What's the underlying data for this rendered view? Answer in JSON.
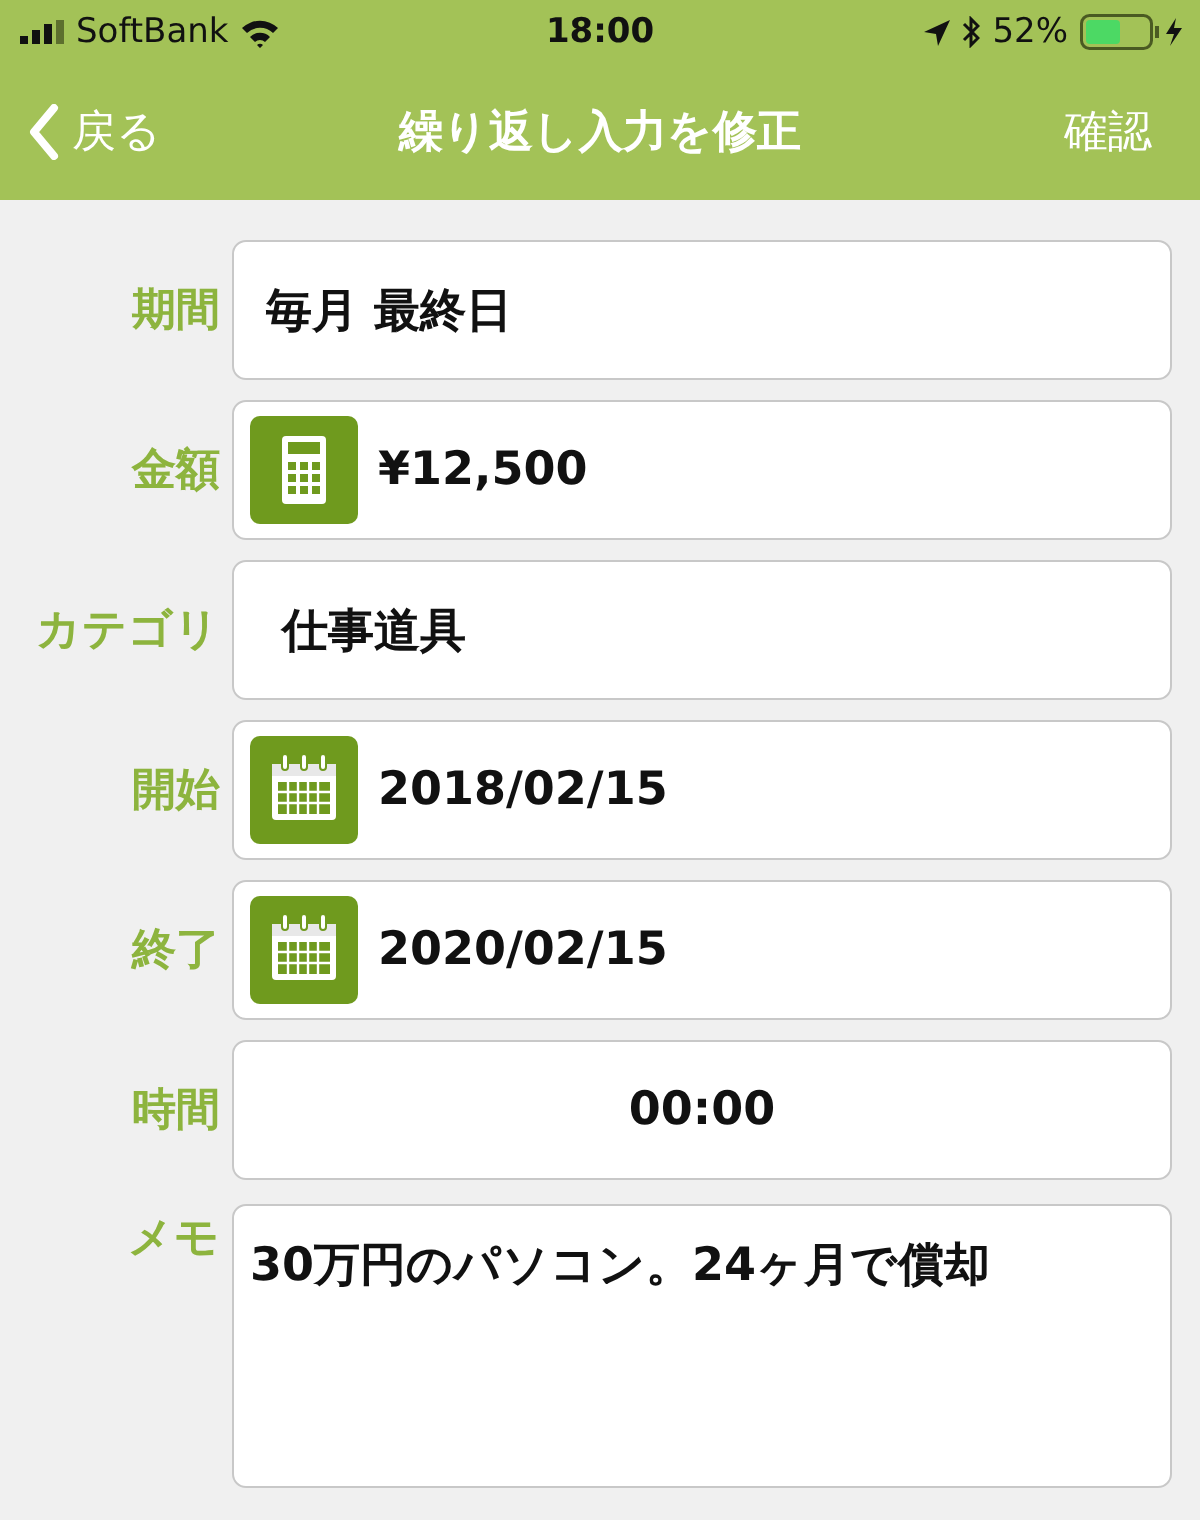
{
  "status_bar": {
    "carrier": "SoftBank",
    "time": "18:00",
    "battery": "52%"
  },
  "nav": {
    "back": "戻る",
    "title": "繰り返し入力を修正",
    "action": "確認"
  },
  "fields": [
    {
      "label": "期間",
      "kind": "text",
      "value": "毎月 最終日"
    },
    {
      "label": "金額",
      "kind": "calculator",
      "value": "¥12,500"
    },
    {
      "label": "カテゴリ",
      "kind": "category",
      "value": "仕事道具"
    },
    {
      "label": "開始",
      "kind": "date",
      "value": "2018/02/15"
    },
    {
      "label": "終了",
      "kind": "date",
      "value": "2020/02/15"
    },
    {
      "label": "時間",
      "kind": "time",
      "value": "00:00"
    },
    {
      "label": "メモ",
      "kind": "memo",
      "value": "30万円のパソコン。24ヶ月で償却"
    }
  ]
}
